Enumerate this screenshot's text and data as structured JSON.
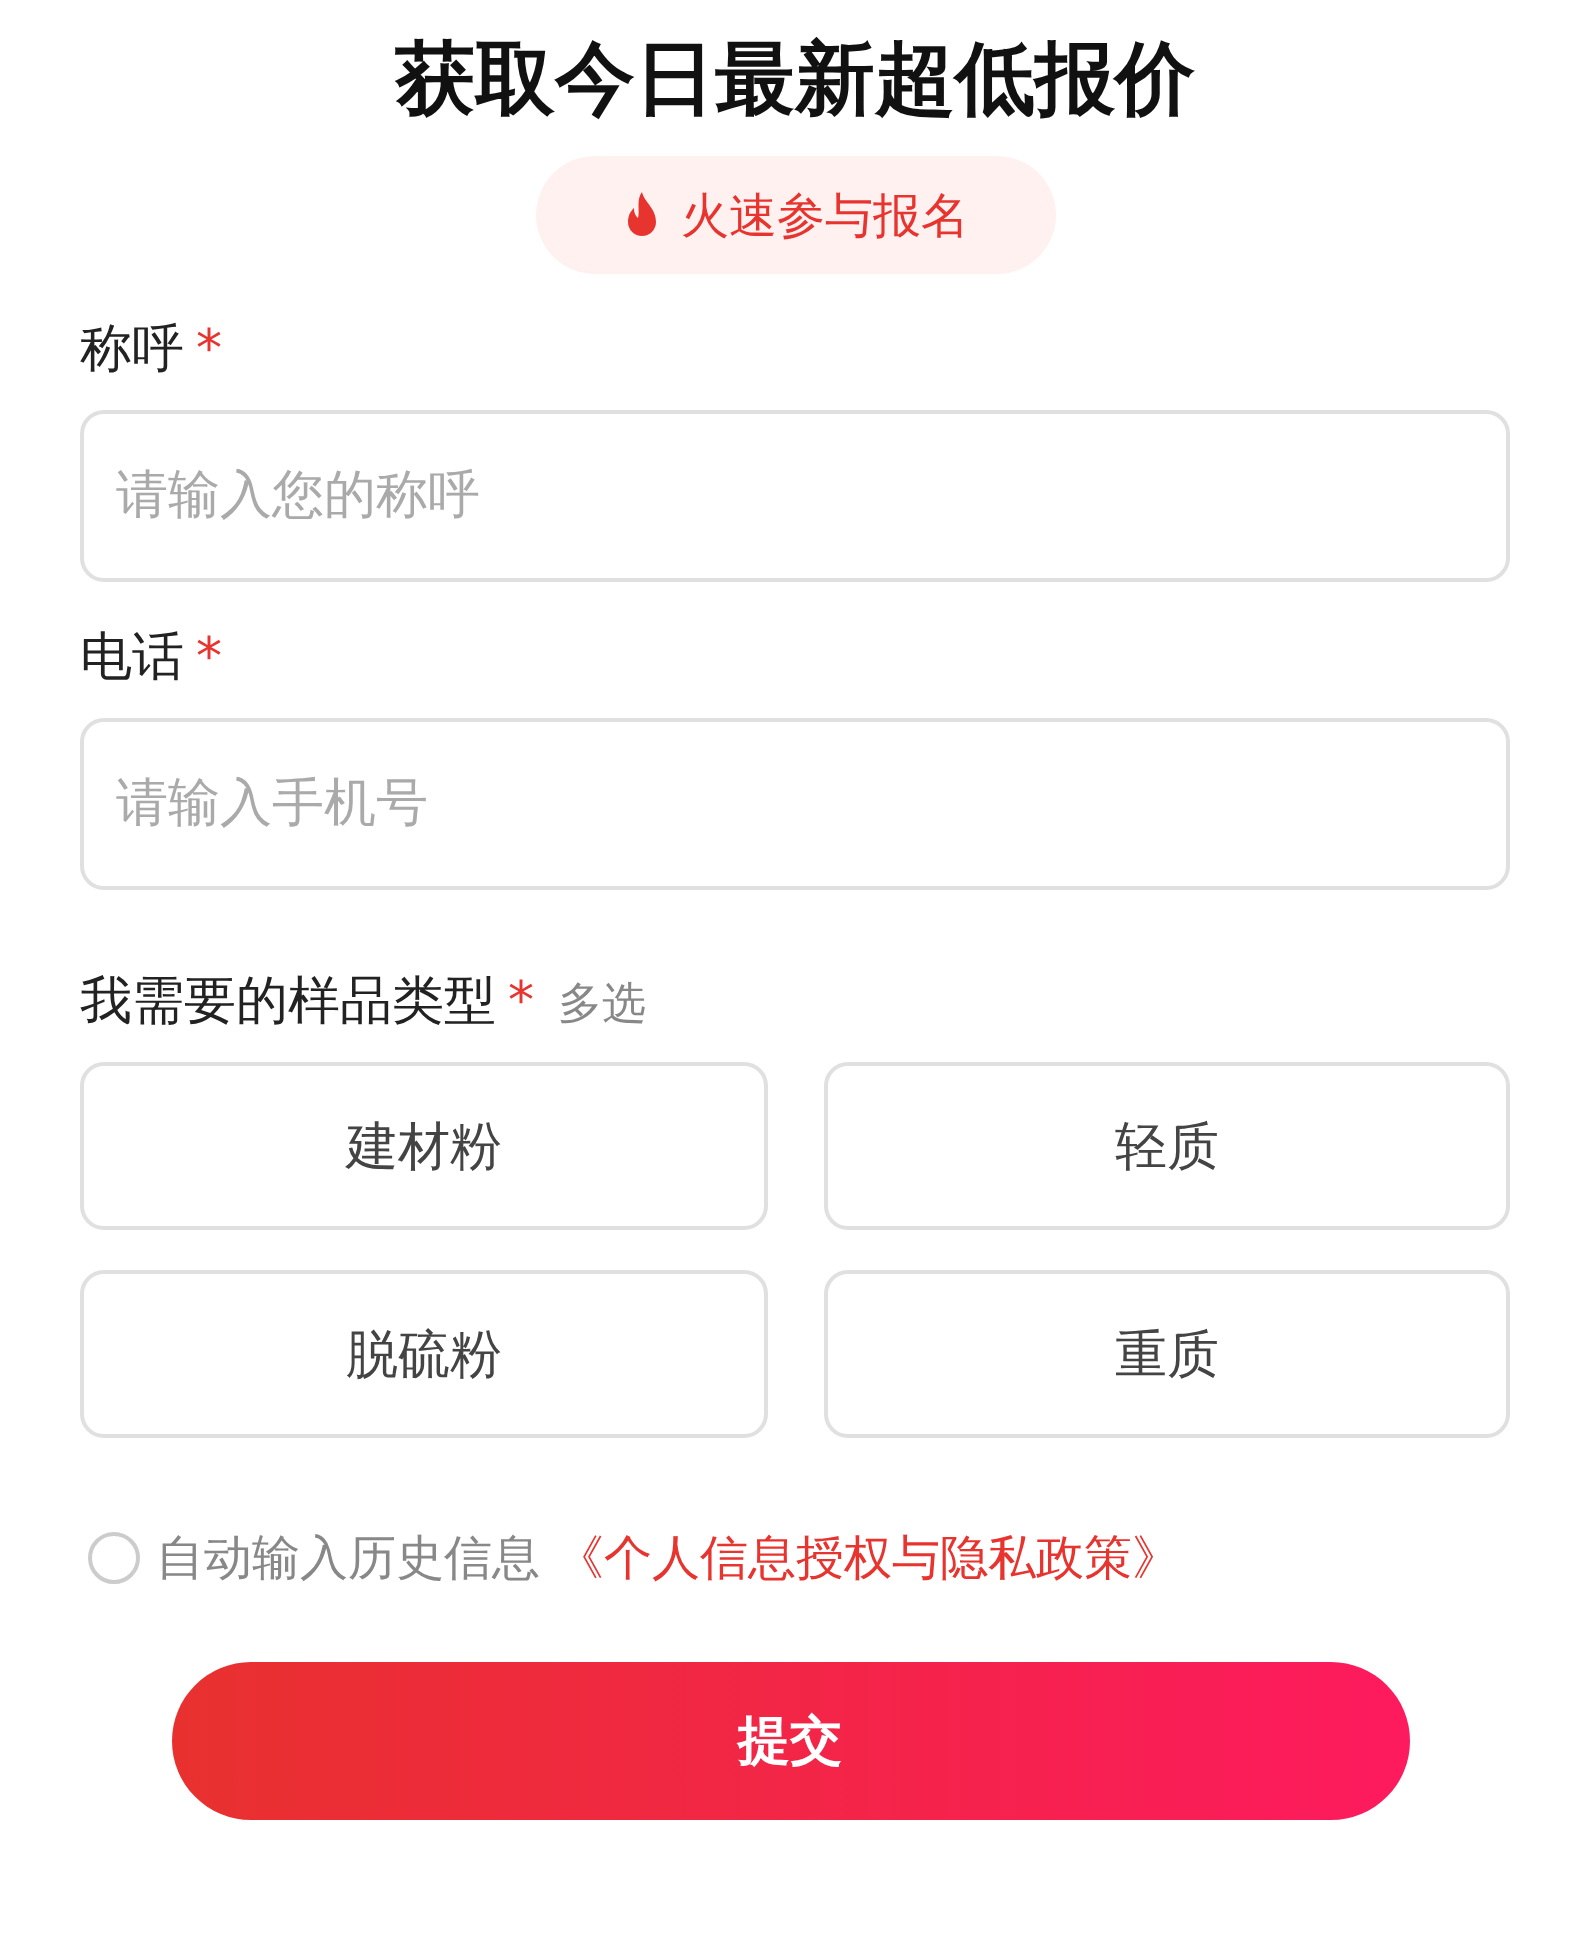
{
  "title": "获取今日最新超低报价",
  "badge": "火速参与报名",
  "fields": [
    {
      "label": "称呼",
      "mark": "*",
      "placeholder": "请输入您的称呼"
    },
    {
      "label": "电话",
      "mark": "*",
      "placeholder": "请输入手机号"
    }
  ],
  "samples": {
    "label": "我需要的样品类型",
    "mark": "*",
    "hint": "多选",
    "options": [
      {
        "label": "建材粉",
        "selected": false
      },
      {
        "label": "轻质",
        "selected": false
      },
      {
        "label": "脱硫粉",
        "selected": false
      },
      {
        "label": "重质",
        "selected": false
      }
    ]
  },
  "consent": {
    "checked": false,
    "text": "自动输入历史信息",
    "link": "《个人信息授权与隐私政策》"
  },
  "submit": "提交"
}
